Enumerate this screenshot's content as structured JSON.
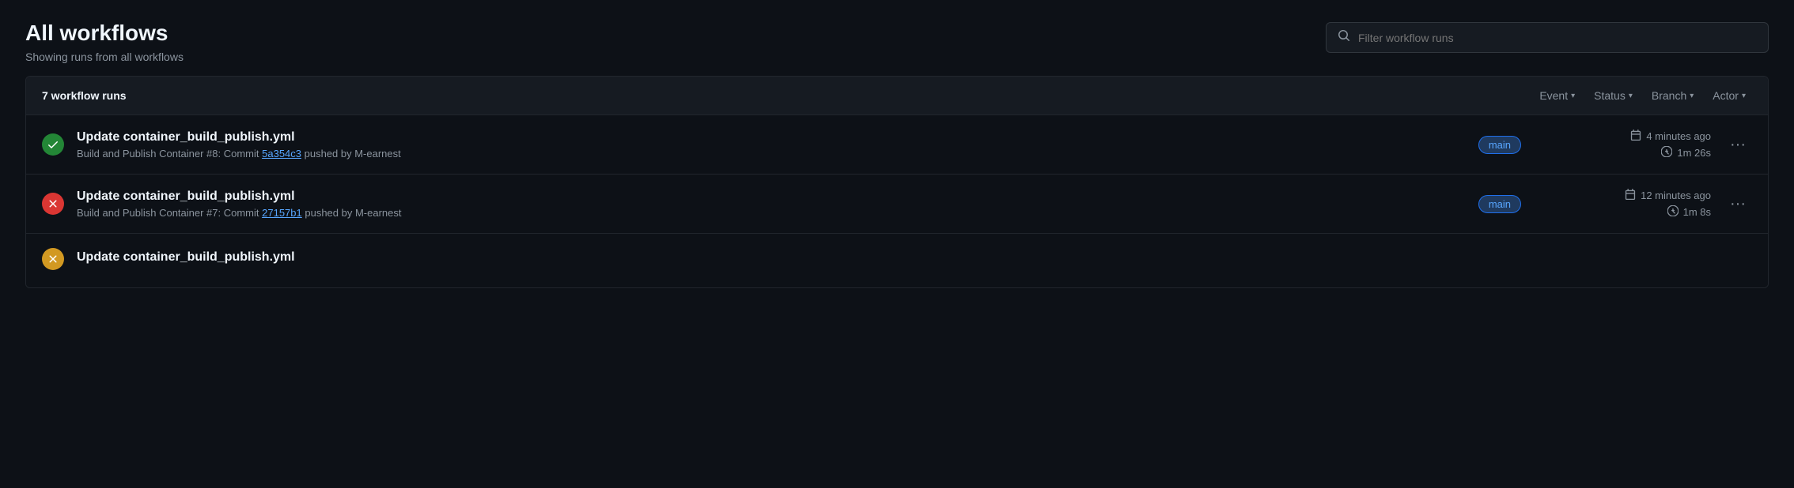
{
  "header": {
    "title": "All workflows",
    "subtitle": "Showing runs from all workflows",
    "search_placeholder": "Filter workflow runs"
  },
  "table": {
    "run_count_label": "7 workflow runs",
    "filters": [
      {
        "label": "Event",
        "id": "event-filter"
      },
      {
        "label": "Status",
        "id": "status-filter"
      },
      {
        "label": "Branch",
        "id": "branch-filter"
      },
      {
        "label": "Actor",
        "id": "actor-filter"
      }
    ],
    "rows": [
      {
        "id": "row-1",
        "status": "success",
        "title": "Update container_build_publish.yml",
        "subtitle_prefix": "Build and Publish Container #8: Commit ",
        "commit": "5a354c3",
        "subtitle_suffix": " pushed by M-earnest",
        "branch": "main",
        "time": "4 minutes ago",
        "duration": "1m 26s"
      },
      {
        "id": "row-2",
        "status": "failure",
        "title": "Update container_build_publish.yml",
        "subtitle_prefix": "Build and Publish Container #7: Commit ",
        "commit": "27157b1",
        "subtitle_suffix": " pushed by M-earnest",
        "branch": "main",
        "time": "12 minutes ago",
        "duration": "1m 8s"
      },
      {
        "id": "row-3",
        "status": "partial",
        "title": "Update container_build_publish.yml",
        "subtitle_prefix": "",
        "commit": "",
        "subtitle_suffix": "",
        "branch": "",
        "time": "",
        "duration": ""
      }
    ]
  }
}
